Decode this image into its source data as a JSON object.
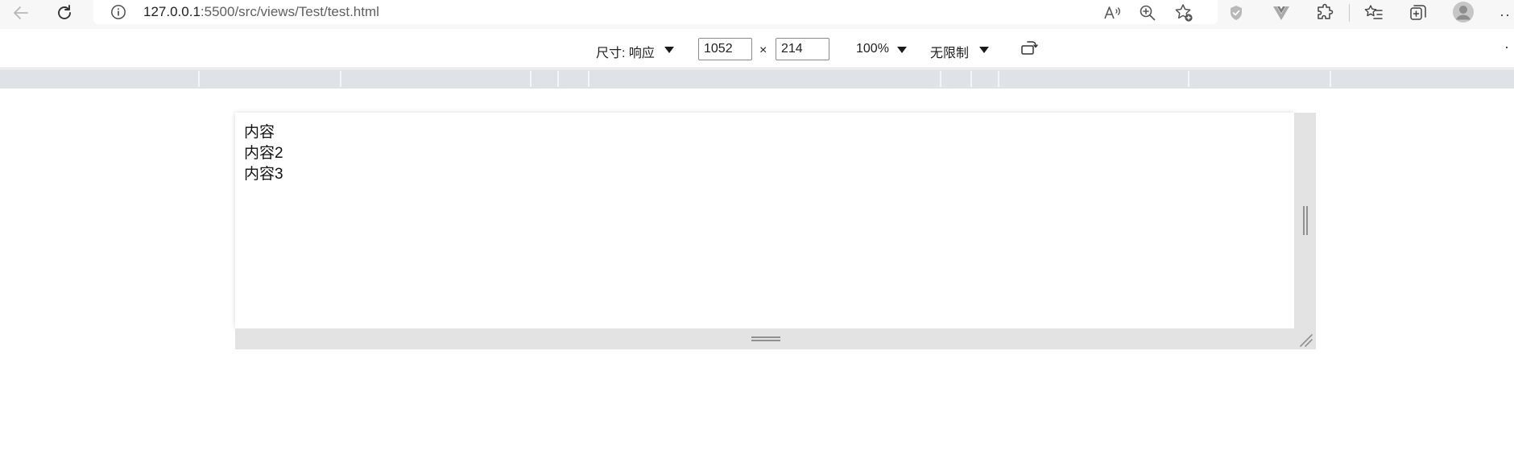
{
  "browser": {
    "url_host": "127.0.0.1",
    "url_rest": ":5500/src/views/Test/test.html"
  },
  "device_toolbar": {
    "dimensions_label": "尺寸: 响应",
    "width_value": "1052",
    "times_sign": "×",
    "height_value": "214",
    "zoom_label": "100%",
    "throttle_label": "无限制"
  },
  "page": {
    "lines": [
      "内容",
      "内容2",
      "内容3"
    ]
  },
  "colors": {
    "toolbar_bg": "#f7f7f7",
    "ruler_bg": "#dfe2e6",
    "handle_bg": "#e3e3e3"
  }
}
